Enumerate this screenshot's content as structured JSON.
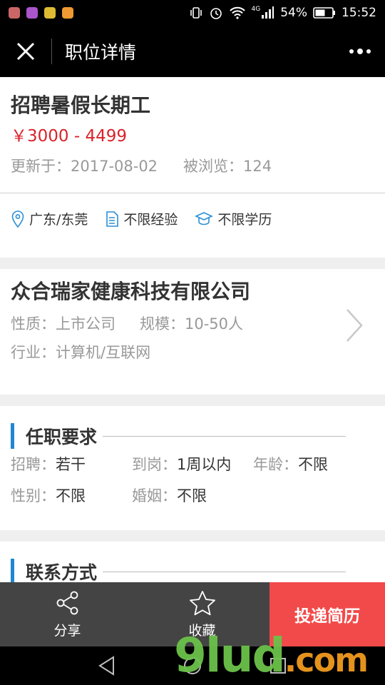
{
  "status": {
    "battery": "54%",
    "time": "15:52",
    "net": "4G"
  },
  "header": {
    "title": "职位详情"
  },
  "job": {
    "title": "招聘暑假长期工",
    "salary": "￥3000 - 4499",
    "updated": "更新于：2017-08-02",
    "views": "被浏览：124",
    "tags": {
      "location": "广东/东莞",
      "experience": "不限经验",
      "education": "不限学历"
    }
  },
  "company": {
    "name": "众合瑞家健康科技有限公司",
    "nature": "性质：上市公司",
    "scale": "规模：10-50人",
    "industry": "行业：计算机/互联网"
  },
  "requirements": {
    "title": "任职要求",
    "items": [
      {
        "key": "招聘：",
        "value": "若干"
      },
      {
        "key": "到岗：",
        "value": "1周以内"
      },
      {
        "key": "年龄：",
        "value": "不限"
      },
      {
        "key": "性别：",
        "value": "不限"
      },
      {
        "key": "婚姻：",
        "value": "不限"
      }
    ]
  },
  "contact": {
    "title": "联系方式"
  },
  "bottom": {
    "share": "分享",
    "favorite": "收藏",
    "apply": "投递简历"
  },
  "watermark": {
    "main": "9lud",
    "suffix": ".com"
  },
  "colors": {
    "salary": "#d9232b",
    "accent": "#1e88d0",
    "apply": "#f24a4a"
  }
}
